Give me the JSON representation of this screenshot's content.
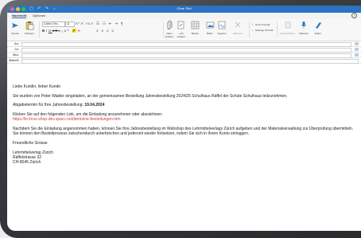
{
  "window": {
    "title": "Ohne Titel"
  },
  "tabs": [
    {
      "label": "Nachricht"
    },
    {
      "label": "Optionen"
    }
  ],
  "ribbon": {
    "send_label": "Senden",
    "paste_label": "Einfügen",
    "font_name": "Calibri (Tex...",
    "font_size": "11",
    "attach_file_label": "Datei anfügen",
    "attach_link_label": "Link anfügen",
    "table_label": "Tabelle",
    "image_label": "Bilder",
    "signature_label": "Signatur",
    "dictate_label": "Diktieren",
    "high_priority_label": "Hohe Priorität",
    "low_priority_label": "Niedrige Priorität",
    "sensitivity_label": "Vertraulichkeit",
    "editor_label": "Editor",
    "voice_label": "Diktieren"
  },
  "headers": {
    "to": "An:",
    "cc": "Cc:",
    "bcc": "Bcc:",
    "subject": "Betreff:"
  },
  "message": {
    "greeting": "Liebe Kundin, lieber Kunde",
    "p1": "Sie wurden von Peter Walder eingeladen, an der gemeinsamen Bestellung Jahresbestellung 2024/25 Schulhaus Räffel der Schule Schulhaus teilzunehmen.",
    "deadline_label": "Abgabetermin für Ihre Jahresbestellung: ",
    "deadline_value": "19.04.2024",
    "p3": "Klicken Sie auf den folgenden Link, um die Einladung anzunehmen oder abzulehnen:",
    "link": "https://lo.lmvz-shop-dev.spacc.net/demeine-bestellungen.htm",
    "p4": "Nachdem Sie die Einladung angenommen haben, können Sie Ihre Jahresbestellung im Webshop des Lehrmittelverlags Zürich aufgeben und der Materialverwaltung zur Überprüfung übermitteln. Sie können den Bestellprozess zwischendurch unterbrechen und jederzeit wieder fortsetzen, indem Sie sich in Ihrem Konto einloggen.",
    "closing": "Freundliche Grüsse",
    "sig1": "Lehrmittelverlag Zürich",
    "sig2": "Räffelstrasse 32",
    "sig3": "CH-8045 Zürich"
  },
  "colors": {
    "titlebar": "#2b72c0",
    "link": "#d0393e",
    "close": "#ff5f57",
    "minimize": "#febc2e",
    "zoom": "#28c840"
  }
}
